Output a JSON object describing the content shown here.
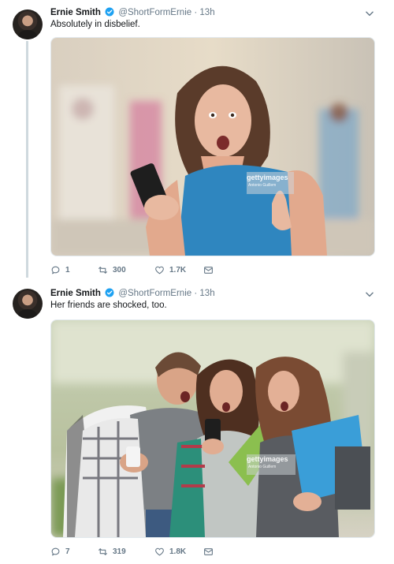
{
  "tweets": [
    {
      "author_name": "Ernie Smith",
      "handle": "@ShortFormErnie",
      "separator": "·",
      "time": "13h",
      "text": "Absolutely in disbelief.",
      "photo_watermark": "gettyimages",
      "photo_credit": "Antonio Guillem",
      "replies": "1",
      "retweets": "300",
      "likes": "1.7K"
    },
    {
      "author_name": "Ernie Smith",
      "handle": "@ShortFormErnie",
      "separator": "·",
      "time": "13h",
      "text": "Her friends are shocked, too.",
      "photo_watermark": "gettyimages",
      "photo_credit": "Antonio Guillem",
      "replies": "7",
      "retweets": "319",
      "likes": "1.8K"
    }
  ],
  "colors": {
    "verified_blue": "#1da1f2",
    "muted_text": "#657786",
    "icon_gray": "#657786",
    "thread_line": "#cfd9de"
  },
  "icons": [
    "verified-icon",
    "chevron-down-icon",
    "reply-icon",
    "retweet-icon",
    "like-icon",
    "message-icon"
  ]
}
